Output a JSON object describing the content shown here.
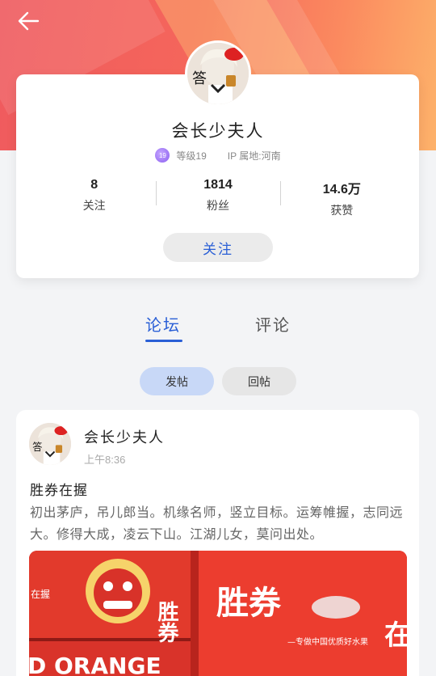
{
  "header": {
    "back_icon": "arrow-left-icon"
  },
  "profile": {
    "nickname": "会长少夫人",
    "level_badge": "19",
    "level_text": "等级19",
    "ip_location": "IP 属地:河南",
    "stats": [
      {
        "value": "8",
        "label": "关注"
      },
      {
        "value": "1814",
        "label": "粉丝"
      },
      {
        "value": "14.6万",
        "label": "获赞"
      }
    ],
    "follow_label": "关注"
  },
  "tabs": {
    "forum": "论坛",
    "comment": "评论"
  },
  "subtabs": {
    "posts": "发帖",
    "replies": "回帖"
  },
  "post": {
    "author": "会长少夫人",
    "time": "上午8:36",
    "title": "胜券在握",
    "body": "初出茅庐，吊儿郎当。机缘名师，竖立目标。运筹帷握，志同远大。修得大成，凌云下山。江湖儿女，莫问出处。",
    "image_text_main": "胜券",
    "image_text_sub": "—专做中国优质好水果",
    "image_text_side": "在",
    "image_text_orange": "D ORANGE",
    "image_text_box": "胜券",
    "image_text_small": "在握"
  },
  "colors": {
    "accent": "#2a5fd6",
    "banner_start": "#ef5a5e",
    "banner_end": "#fdb26a"
  }
}
